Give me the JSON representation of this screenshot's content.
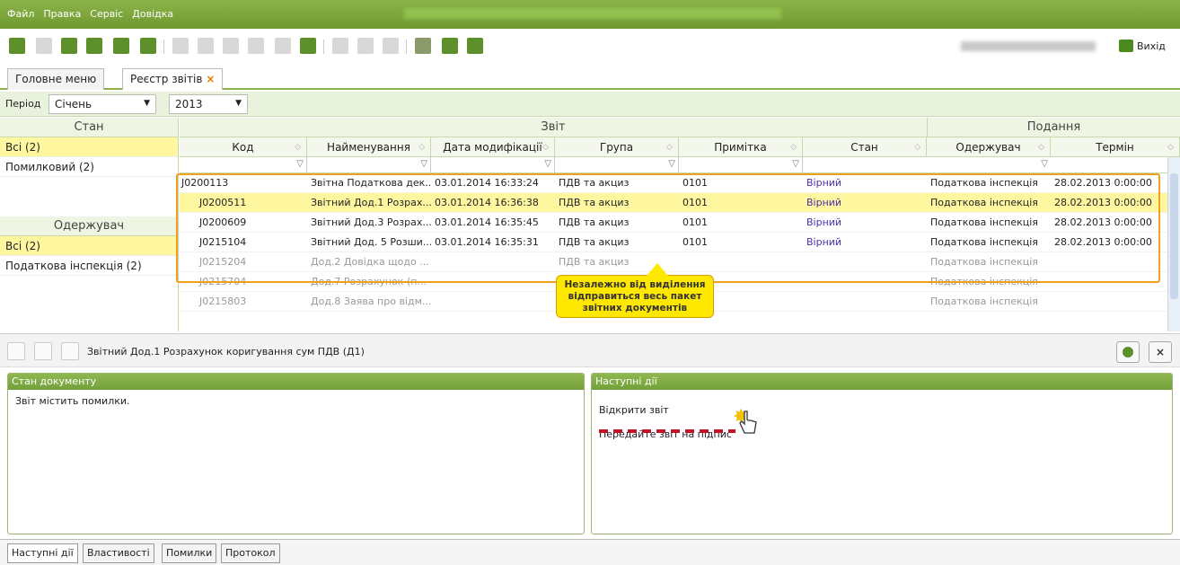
{
  "menu": {
    "items": [
      "Файл",
      "Правка",
      "Сервіс",
      "Довідка"
    ]
  },
  "toolbar": {
    "exit_label": "Вихід"
  },
  "tabs": [
    {
      "label": "Головне меню"
    },
    {
      "label": "Реєстр звітів",
      "close": "×"
    }
  ],
  "period": {
    "label": "Період",
    "month": "Січень",
    "year": "2013"
  },
  "left_panel": {
    "state_header": "Стан",
    "state_items": [
      "Всі (2)",
      "Помилковий (2)"
    ],
    "recipient_header": "Одержувач",
    "recipient_items": [
      "Всі (2)",
      "Податкова інспекція (2)"
    ]
  },
  "grid": {
    "group_headers": {
      "report": "Звіт",
      "submission": "Подання"
    },
    "columns": [
      "Код",
      "Найменування",
      "Дата модифікації",
      "Група",
      "Примітка",
      "Стан",
      "Одержувач",
      "Термін"
    ],
    "rows": [
      {
        "code": "J0200113",
        "name": "Звітна Податкова дек...",
        "date": "03.01.2014 16:33:24",
        "group": "ПДВ та акциз",
        "note": "0101",
        "state": "Вірний",
        "recipient": "Податкова інспекція",
        "term": "28.02.2013 0:00:00"
      },
      {
        "code": "J0200511",
        "name": "Звітний Дод.1 Розрах...",
        "date": "03.01.2014 16:36:38",
        "group": "ПДВ та акциз",
        "note": "0101",
        "state": "Вірний",
        "recipient": "Податкова інспекція",
        "term": "28.02.2013 0:00:00"
      },
      {
        "code": "J0200609",
        "name": "Звітний Дод.3 Розрах...",
        "date": "03.01.2014 16:35:45",
        "group": "ПДВ та акциз",
        "note": "0101",
        "state": "Вірний",
        "recipient": "Податкова інспекція",
        "term": "28.02.2013 0:00:00"
      },
      {
        "code": "J0215104",
        "name": "Звітний Дод. 5 Розши...",
        "date": "03.01.2014 16:35:31",
        "group": "ПДВ та акциз",
        "note": "0101",
        "state": "Вірний",
        "recipient": "Податкова інспекція",
        "term": "28.02.2013 0:00:00"
      },
      {
        "code": "J0215204",
        "name": "Дод.2 Довідка щодо ...",
        "date": "",
        "group": "ПДВ та акциз",
        "note": "",
        "state": "",
        "recipient": "Податкова інспекція",
        "term": ""
      },
      {
        "code": "J0215704",
        "name": "Дод.7 Розрахунок (п...",
        "date": "",
        "group": "",
        "note": "",
        "state": "",
        "recipient": "Податкова інспекція",
        "term": ""
      },
      {
        "code": "J0215803",
        "name": "Дод.8 Заява про відм...",
        "date": "",
        "group": "",
        "note": "",
        "state": "",
        "recipient": "Податкова інспекція",
        "term": ""
      }
    ]
  },
  "callout": {
    "text": "Незалежно від виділення відправиться весь пакет звітних документів"
  },
  "document": {
    "title": "Звітний Дод.1 Розрахунок коригування сум ПДВ (Д1)",
    "close": "×"
  },
  "doc_state": {
    "header": "Стан документу",
    "text": "Звіт містить помилки."
  },
  "next_actions": {
    "header": "Наступні дії",
    "open": "Відкрити звіт",
    "sign": "Передайте звіт на підпис"
  },
  "bottom_tabs": [
    "Наступні дії",
    "Властивості",
    "Помилки",
    "Протокол"
  ],
  "colors": {
    "accent": "#7aa83a",
    "selected_row": "#fff7a0",
    "highlight": "#f0a020",
    "callout": "#ffe800",
    "state_text": "#4a2ea6"
  }
}
